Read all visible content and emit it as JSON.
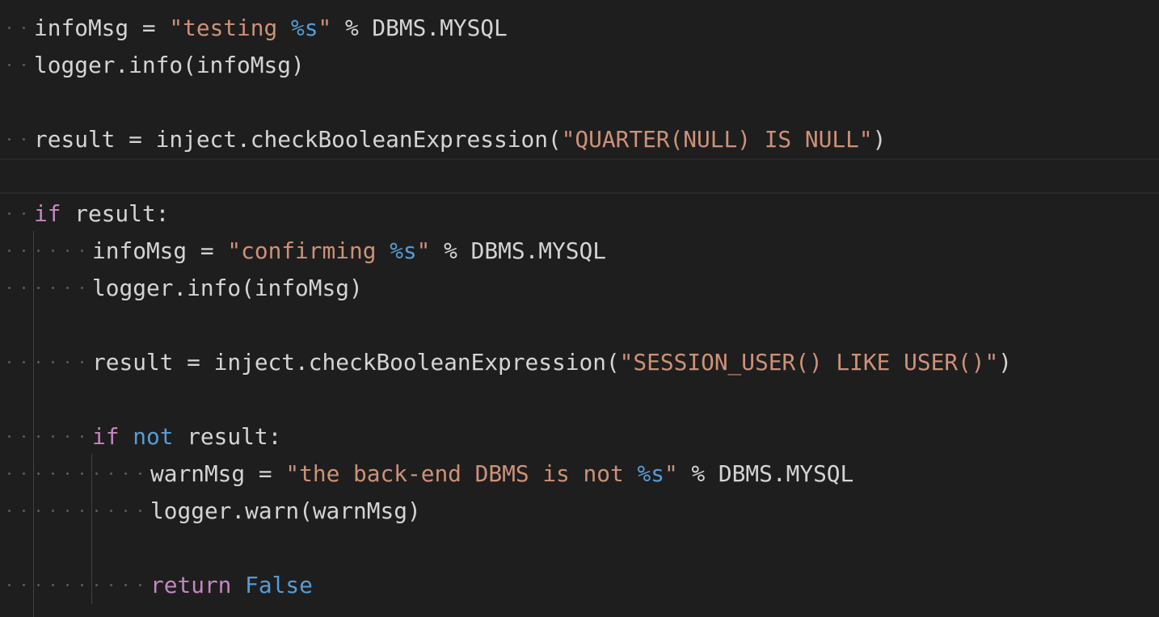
{
  "editor": {
    "language": "python",
    "theme": "dark",
    "colors": {
      "background": "#1e1e1e",
      "text": "#d4d4d4",
      "string": "#ce9178",
      "format_specifier": "#569cd6",
      "keyword": "#c586c0",
      "constant": "#569cd6",
      "whitespace_dot": "#5c5c5c",
      "indent_guide": "#404040"
    },
    "lines": [
      {
        "indent": 1,
        "tokens": [
          {
            "t": "infoMsg = ",
            "c": "def"
          },
          {
            "t": "\"testing ",
            "c": "str"
          },
          {
            "t": "%s",
            "c": "fmt"
          },
          {
            "t": "\"",
            "c": "str"
          },
          {
            "t": " % DBMS.MYSQL",
            "c": "def"
          }
        ]
      },
      {
        "indent": 1,
        "tokens": [
          {
            "t": "logger.info(infoMsg)",
            "c": "def"
          }
        ]
      },
      {
        "indent": 0,
        "tokens": []
      },
      {
        "indent": 1,
        "tokens": [
          {
            "t": "result = inject.checkBooleanExpression(",
            "c": "def"
          },
          {
            "t": "\"QUARTER(NULL) IS NULL\"",
            "c": "str"
          },
          {
            "t": ")",
            "c": "def"
          }
        ]
      },
      {
        "indent": 0,
        "tokens": [],
        "current": true
      },
      {
        "indent": 1,
        "tokens": [
          {
            "t": "if",
            "c": "kw"
          },
          {
            "t": " result:",
            "c": "def"
          }
        ]
      },
      {
        "indent": 2,
        "tokens": [
          {
            "t": "infoMsg = ",
            "c": "def"
          },
          {
            "t": "\"confirming ",
            "c": "str"
          },
          {
            "t": "%s",
            "c": "fmt"
          },
          {
            "t": "\"",
            "c": "str"
          },
          {
            "t": " % DBMS.MYSQL",
            "c": "def"
          }
        ]
      },
      {
        "indent": 2,
        "tokens": [
          {
            "t": "logger.info(infoMsg)",
            "c": "def"
          }
        ]
      },
      {
        "indent": 0,
        "tokens": []
      },
      {
        "indent": 2,
        "tokens": [
          {
            "t": "result = inject.checkBooleanExpression(",
            "c": "def"
          },
          {
            "t": "\"SESSION_USER() LIKE USER()\"",
            "c": "str"
          },
          {
            "t": ")",
            "c": "def"
          }
        ]
      },
      {
        "indent": 0,
        "tokens": []
      },
      {
        "indent": 2,
        "tokens": [
          {
            "t": "if",
            "c": "kw"
          },
          {
            "t": " ",
            "c": "def"
          },
          {
            "t": "not",
            "c": "const"
          },
          {
            "t": " result:",
            "c": "def"
          }
        ]
      },
      {
        "indent": 3,
        "tokens": [
          {
            "t": "warnMsg = ",
            "c": "def"
          },
          {
            "t": "\"the back-end DBMS is not ",
            "c": "str"
          },
          {
            "t": "%s",
            "c": "fmt"
          },
          {
            "t": "\"",
            "c": "str"
          },
          {
            "t": " % DBMS.MYSQL",
            "c": "def"
          }
        ]
      },
      {
        "indent": 3,
        "tokens": [
          {
            "t": "logger.warn(warnMsg)",
            "c": "def"
          }
        ]
      },
      {
        "indent": 0,
        "tokens": []
      },
      {
        "indent": 3,
        "tokens": [
          {
            "t": "return",
            "c": "kw"
          },
          {
            "t": " ",
            "c": "def"
          },
          {
            "t": "False",
            "c": "const"
          }
        ]
      }
    ]
  }
}
